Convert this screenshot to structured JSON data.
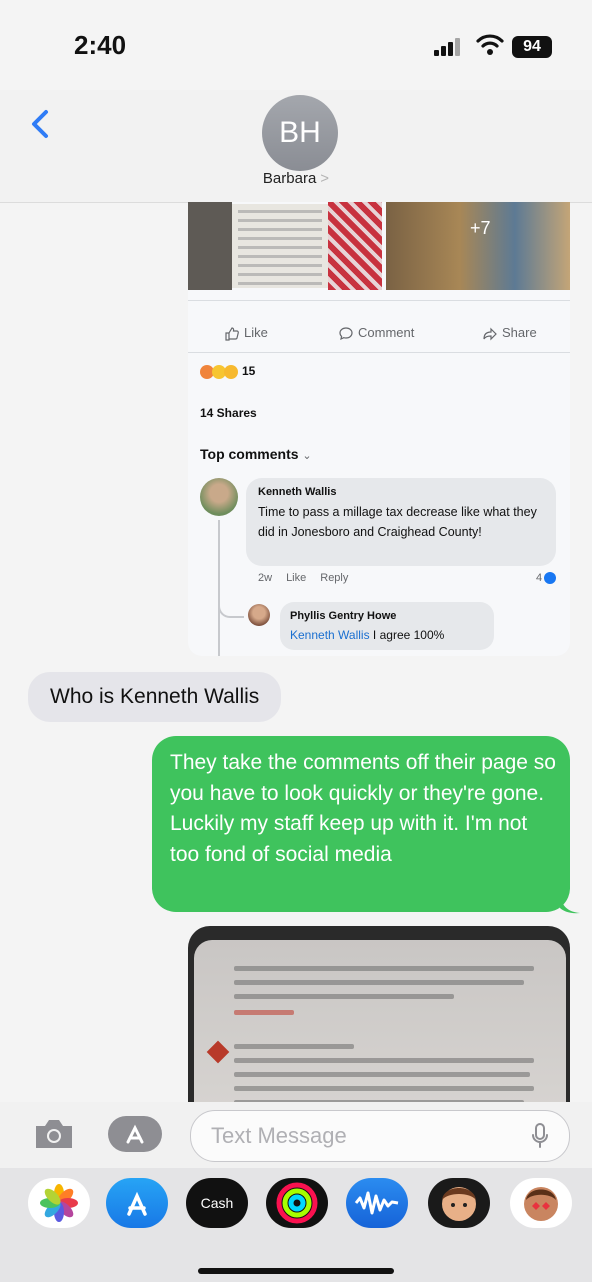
{
  "status_bar": {
    "time": "2:40",
    "battery": "94"
  },
  "header": {
    "avatar_initials": "BH",
    "contact_name": "Barbara",
    "contact_chevron": ">"
  },
  "fb_post": {
    "more_photos": "+7",
    "actions": {
      "like": "Like",
      "comment": "Comment",
      "share": "Share"
    },
    "reaction_count": "15",
    "shares": "14 Shares",
    "top_comments": "Top comments",
    "comment": {
      "author": "Kenneth Wallis",
      "text": "Time to pass a millage tax decrease like what they did in Jonesboro and Craighead County!",
      "age": "2w",
      "like": "Like",
      "reply": "Reply",
      "reaction_count": "4"
    },
    "reply": {
      "author": "Phyllis Gentry Howe",
      "mention": "Kenneth Wallis",
      "text": " I agree 100%"
    }
  },
  "messages": {
    "incoming": "Who is Kenneth Wallis",
    "outgoing": "They take the comments off their page so you have to look quickly or they're gone. Luckily my staff keep up with it. I'm not too fond of social media"
  },
  "compose": {
    "placeholder": "Text Message"
  },
  "app_drawer": {
    "apps": [
      "photos-app",
      "app-store-app",
      "apple-cash-app",
      "activity-app",
      "audio-message-app",
      "memoji-app",
      "memoji-stickers-app"
    ],
    "cash_label": "Cash"
  },
  "colors": {
    "outgoing_bubble": "#3fc35d",
    "incoming_bubble": "#e5e5ea",
    "ios_blue": "#2f7cf6",
    "fb_blue": "#1877f2"
  }
}
